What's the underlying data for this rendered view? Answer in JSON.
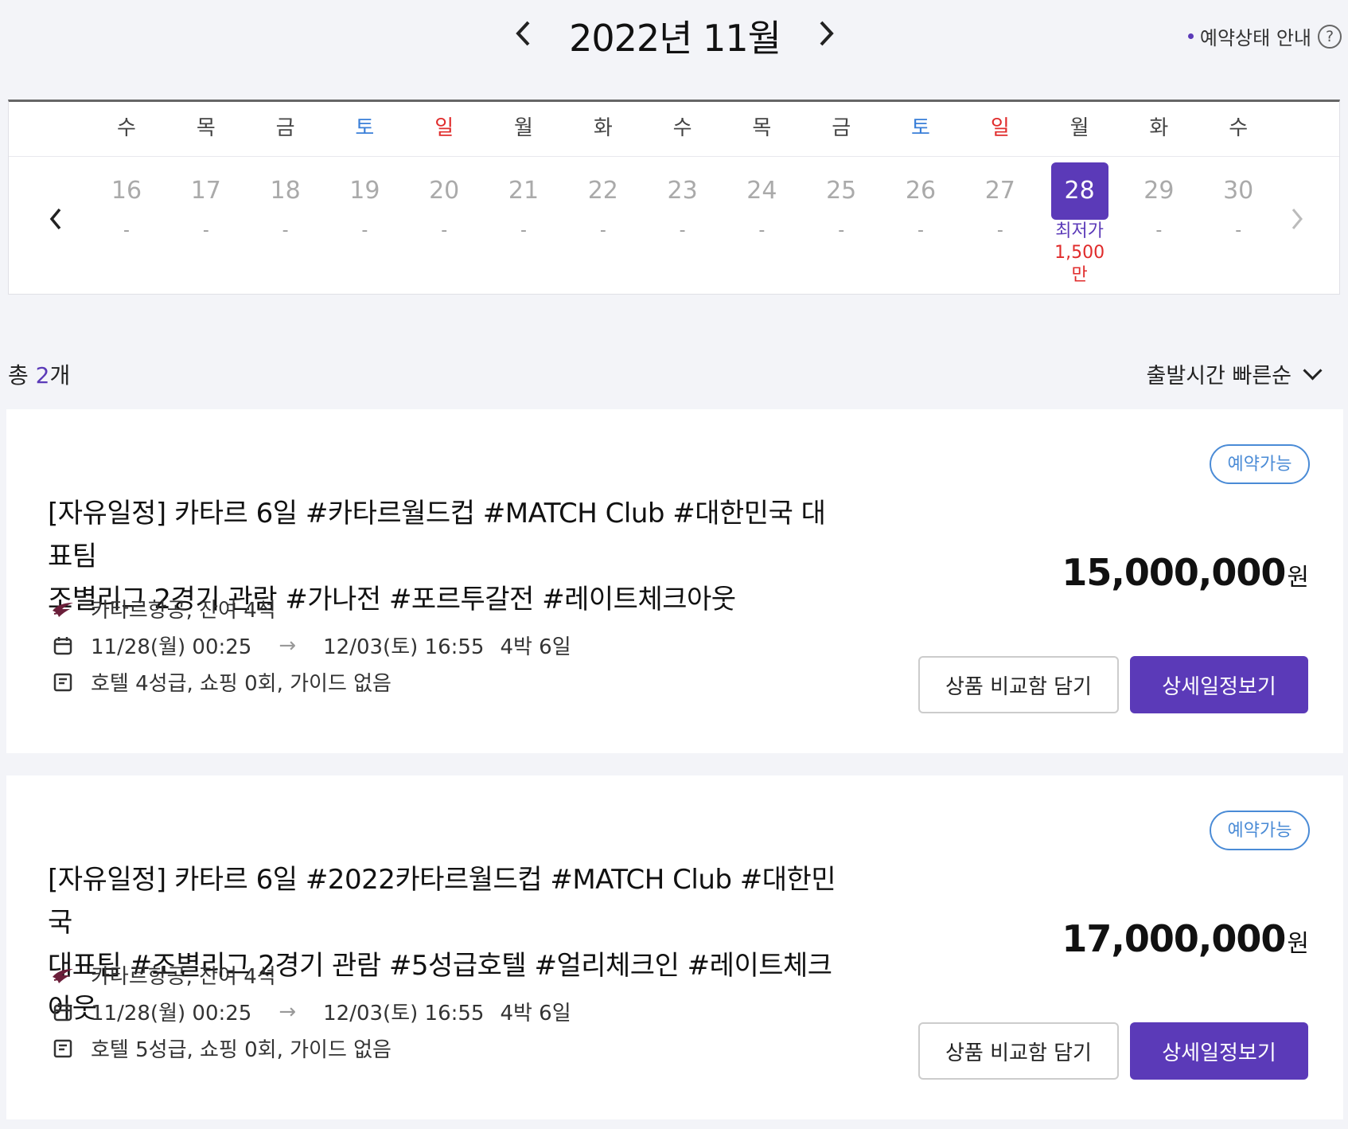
{
  "header": {
    "month_title": "2022년 11월",
    "prev_icon": "chevron-left-icon",
    "next_icon": "chevron-right-icon",
    "status_guide": "예약상태 안내",
    "help_symbol": "?"
  },
  "calendar": {
    "weekdays": [
      "수",
      "목",
      "금",
      "토",
      "일",
      "월",
      "화",
      "수",
      "목",
      "금",
      "토",
      "일",
      "월",
      "화",
      "수"
    ],
    "days": [
      {
        "num": "16",
        "sub": "-"
      },
      {
        "num": "17",
        "sub": "-"
      },
      {
        "num": "18",
        "sub": "-"
      },
      {
        "num": "19",
        "sub": "-"
      },
      {
        "num": "20",
        "sub": "-"
      },
      {
        "num": "21",
        "sub": "-"
      },
      {
        "num": "22",
        "sub": "-"
      },
      {
        "num": "23",
        "sub": "-"
      },
      {
        "num": "24",
        "sub": "-"
      },
      {
        "num": "25",
        "sub": "-"
      },
      {
        "num": "26",
        "sub": "-"
      },
      {
        "num": "27",
        "sub": "-"
      },
      {
        "num": "28",
        "sub": "최저가",
        "price": "1,500만",
        "selected": true
      },
      {
        "num": "29",
        "sub": "-"
      },
      {
        "num": "30",
        "sub": "-"
      }
    ],
    "selected_color": "#5b3ab8",
    "saturday_color": "#3a7fd8",
    "sunday_color": "#e02b2b"
  },
  "results": {
    "total_prefix": "총 ",
    "total_count": "2",
    "total_suffix": "개",
    "sort_label": "출발시간 빠른순"
  },
  "products": [
    {
      "badge": "예약가능",
      "title_line1": "[자유일정] 카타르 6일 #카타르월드컵 #MATCH Club #대한민국 대표팀",
      "title_line2": "조별리그 2경기 관람 #가나전 #포르투갈전 #레이트체크아웃",
      "airline": "카타르항공, 잔여 4석",
      "depart": "11/28(월) 00:25",
      "arrow": "→",
      "return": "12/03(토) 16:55",
      "duration": "4박 6일",
      "details": "호텔 4성급,  쇼핑 0회,  가이드 없음",
      "price": "15,000,000",
      "currency": "원",
      "compare_label": "상품 비교함 담기",
      "detail_label": "상세일정보기"
    },
    {
      "badge": "예약가능",
      "title_line1": "[자유일정] 카타르 6일 #2022카타르월드컵 #MATCH Club #대한민국",
      "title_line2": "대표팀 #조별리그 2경기 관람 #5성급호텔 #얼리체크인 #레이트체크아웃",
      "airline": "카타르항공, 잔여 4석",
      "depart": "11/28(월) 00:25",
      "arrow": "→",
      "return": "12/03(토) 16:55",
      "duration": "4박 6일",
      "details": "호텔 5성급,  쇼핑 0회,  가이드 없음",
      "price": "17,000,000",
      "currency": "원",
      "compare_label": "상품 비교함 담기",
      "detail_label": "상세일정보기"
    }
  ],
  "accent_color": "#5b3ab8"
}
